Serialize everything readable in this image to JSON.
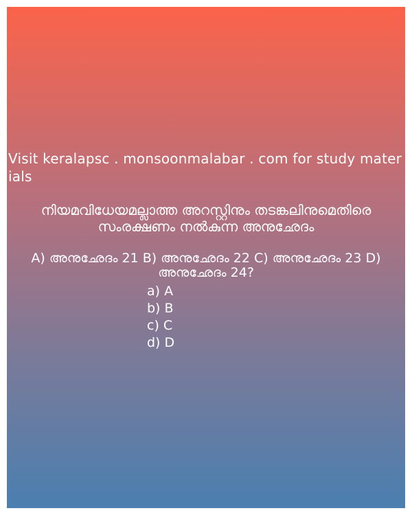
{
  "promo": {
    "text": "Visit keralapsc . monsoonmalabar . com for study materials"
  },
  "question": {
    "text": "നിയമവിധേയമല്ലാത്ത അറസ്റ്റിനും തടങ്കലിനുമെതിരെ സംരക്ഷണം നൽകുന്ന അനുഛേദം",
    "choices_line": "A) അനുഛേദം 21 B) അനുഛേദം 22 C) അനുഛേദം 23 D) അനുഛേദം 24?"
  },
  "options": [
    "a) A",
    "b) B",
    "c) C",
    "d) D"
  ],
  "colors": {
    "gradient_top": "#fb634a",
    "gradient_bottom": "#4a7fb0",
    "text": "#ffffff"
  }
}
